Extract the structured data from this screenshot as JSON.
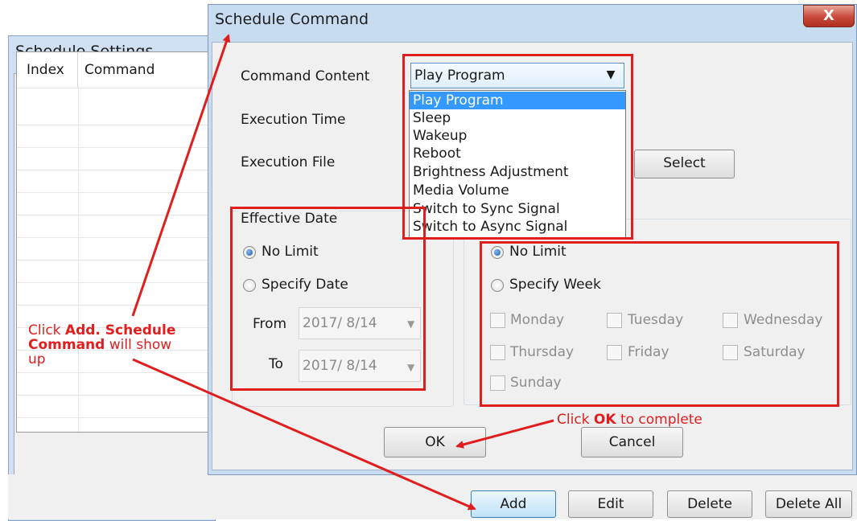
{
  "settings_window": {
    "title": "Schedule Settings",
    "columns": [
      "Index",
      "Command"
    ],
    "buttons": {
      "add": "Add",
      "edit": "Edit",
      "delete": "Delete",
      "delete_all": "Delete All"
    }
  },
  "dialog": {
    "title": "Schedule Command",
    "close_label": "X",
    "labels": {
      "command_content": "Command Content",
      "execution_time": "Execution Time",
      "execution_file": "Execution File"
    },
    "command_combo": {
      "selected": "Play Program",
      "options": [
        "Play Program",
        "Sleep",
        "Wakeup",
        "Reboot",
        "Brightness Adjustment",
        "Media Volume",
        "Switch to Sync Signal",
        "Switch to Async Signal"
      ]
    },
    "select_button": "Select",
    "effective_date": {
      "title": "Effective Date",
      "no_limit": "No Limit",
      "specify_date": "Specify Date",
      "from_label": "From",
      "to_label": "To",
      "from_value": "2017/ 8/14",
      "to_value": "2017/ 8/14"
    },
    "week": {
      "no_limit": "No Limit",
      "specify_week": "Specify Week",
      "days": [
        "Monday",
        "Tuesday",
        "Wednesday",
        "Thursday",
        "Friday",
        "Saturday",
        "Sunday"
      ]
    },
    "ok": "OK",
    "cancel": "Cancel"
  },
  "annotations": {
    "add_note": {
      "pre": "Click ",
      "bold": "Add. Schedule Command",
      "post": " will show up"
    },
    "ok_note": {
      "pre": "Click ",
      "bold": "OK",
      "post": " to complete"
    },
    "color": "#e01e1e"
  }
}
